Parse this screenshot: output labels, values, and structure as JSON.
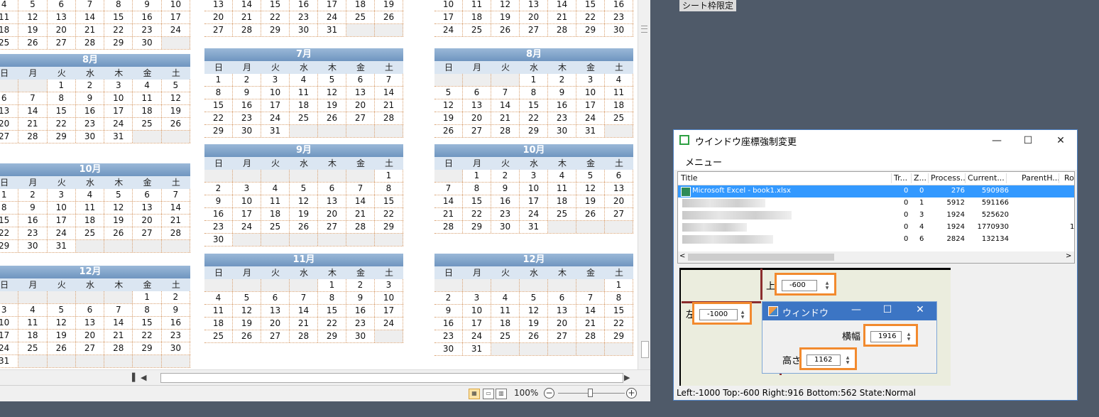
{
  "excel": {
    "calendars": [
      {
        "id": "col1-top",
        "month": "",
        "weekdays": [],
        "weeks": [
          [
            "4",
            "5",
            "6",
            "7",
            "8",
            "9",
            "10"
          ],
          [
            "11",
            "12",
            "13",
            "14",
            "15",
            "16",
            "17"
          ],
          [
            "18",
            "19",
            "20",
            "21",
            "22",
            "23",
            "24"
          ],
          [
            "25",
            "26",
            "27",
            "28",
            "29",
            "30",
            ""
          ]
        ]
      },
      {
        "id": "col1-aug",
        "month": "8月",
        "weekdays": [
          "日",
          "月",
          "火",
          "水",
          "木",
          "金",
          "土"
        ],
        "weeks": [
          [
            "",
            "",
            "1",
            "2",
            "3",
            "4",
            "5"
          ],
          [
            "6",
            "7",
            "8",
            "9",
            "10",
            "11",
            "12"
          ],
          [
            "13",
            "14",
            "15",
            "16",
            "17",
            "18",
            "19"
          ],
          [
            "20",
            "21",
            "22",
            "23",
            "24",
            "25",
            "26"
          ],
          [
            "27",
            "28",
            "29",
            "30",
            "31",
            "",
            ""
          ]
        ]
      },
      {
        "id": "col1-oct",
        "month": "10月",
        "weekdays": [
          "日",
          "月",
          "火",
          "水",
          "木",
          "金",
          "土"
        ],
        "weeks": [
          [
            "1",
            "2",
            "3",
            "4",
            "5",
            "6",
            "7"
          ],
          [
            "8",
            "9",
            "10",
            "11",
            "12",
            "13",
            "14"
          ],
          [
            "15",
            "16",
            "17",
            "18",
            "19",
            "20",
            "21"
          ],
          [
            "22",
            "23",
            "24",
            "25",
            "26",
            "27",
            "28"
          ],
          [
            "29",
            "30",
            "31",
            "",
            "",
            "",
            ""
          ]
        ]
      },
      {
        "id": "col1-dec",
        "month": "12月",
        "weekdays": [
          "日",
          "月",
          "火",
          "水",
          "木",
          "金",
          "土"
        ],
        "weeks": [
          [
            "",
            "",
            "",
            "",
            "",
            "1",
            "2"
          ],
          [
            "3",
            "4",
            "5",
            "6",
            "7",
            "8",
            "9"
          ],
          [
            "10",
            "11",
            "12",
            "13",
            "14",
            "15",
            "16"
          ],
          [
            "17",
            "18",
            "19",
            "20",
            "21",
            "22",
            "23"
          ],
          [
            "24",
            "25",
            "26",
            "27",
            "28",
            "29",
            "30"
          ],
          [
            "31",
            "",
            "",
            "",
            "",
            "",
            ""
          ]
        ]
      },
      {
        "id": "col2-top",
        "month": "",
        "weekdays": [],
        "weeks": [
          [
            "13",
            "14",
            "15",
            "16",
            "17",
            "18",
            "19"
          ],
          [
            "20",
            "21",
            "22",
            "23",
            "24",
            "25",
            "26"
          ],
          [
            "27",
            "28",
            "29",
            "30",
            "31",
            "",
            ""
          ]
        ]
      },
      {
        "id": "col2-jul",
        "month": "7月",
        "weekdays": [
          "日",
          "月",
          "火",
          "水",
          "木",
          "金",
          "土"
        ],
        "weeks": [
          [
            "1",
            "2",
            "3",
            "4",
            "5",
            "6",
            "7"
          ],
          [
            "8",
            "9",
            "10",
            "11",
            "12",
            "13",
            "14"
          ],
          [
            "15",
            "16",
            "17",
            "18",
            "19",
            "20",
            "21"
          ],
          [
            "22",
            "23",
            "24",
            "25",
            "26",
            "27",
            "28"
          ],
          [
            "29",
            "30",
            "31",
            "",
            "",
            "",
            ""
          ]
        ]
      },
      {
        "id": "col2-sep",
        "month": "9月",
        "weekdays": [
          "日",
          "月",
          "火",
          "水",
          "木",
          "金",
          "土"
        ],
        "weeks": [
          [
            "",
            "",
            "",
            "",
            "",
            "",
            "1"
          ],
          [
            "2",
            "3",
            "4",
            "5",
            "6",
            "7",
            "8"
          ],
          [
            "9",
            "10",
            "11",
            "12",
            "13",
            "14",
            "15"
          ],
          [
            "16",
            "17",
            "18",
            "19",
            "20",
            "21",
            "22"
          ],
          [
            "23",
            "24",
            "25",
            "26",
            "27",
            "28",
            "29"
          ],
          [
            "30",
            "",
            "",
            "",
            "",
            "",
            ""
          ]
        ]
      },
      {
        "id": "col2-nov",
        "month": "11月",
        "weekdays": [
          "日",
          "月",
          "火",
          "水",
          "木",
          "金",
          "土"
        ],
        "weeks": [
          [
            "",
            "",
            "",
            "",
            "1",
            "2",
            "3"
          ],
          [
            "4",
            "5",
            "6",
            "7",
            "8",
            "9",
            "10"
          ],
          [
            "11",
            "12",
            "13",
            "14",
            "15",
            "16",
            "17"
          ],
          [
            "18",
            "19",
            "20",
            "21",
            "22",
            "23",
            "24"
          ],
          [
            "25",
            "26",
            "27",
            "28",
            "29",
            "30",
            ""
          ]
        ]
      },
      {
        "id": "col3-top",
        "month": "",
        "weekdays": [],
        "weeks": [
          [
            "10",
            "11",
            "12",
            "13",
            "14",
            "15",
            "16"
          ],
          [
            "17",
            "18",
            "19",
            "20",
            "21",
            "22",
            "23"
          ],
          [
            "24",
            "25",
            "26",
            "27",
            "28",
            "29",
            "30"
          ]
        ]
      },
      {
        "id": "col3-aug",
        "month": "8月",
        "weekdays": [
          "日",
          "月",
          "火",
          "水",
          "木",
          "金",
          "土"
        ],
        "weeks": [
          [
            "",
            "",
            "",
            "1",
            "2",
            "3",
            "4"
          ],
          [
            "5",
            "6",
            "7",
            "8",
            "9",
            "10",
            "11"
          ],
          [
            "12",
            "13",
            "14",
            "15",
            "16",
            "17",
            "18"
          ],
          [
            "19",
            "20",
            "21",
            "22",
            "23",
            "24",
            "25"
          ],
          [
            "26",
            "27",
            "28",
            "29",
            "30",
            "31",
            ""
          ]
        ]
      },
      {
        "id": "col3-oct",
        "month": "10月",
        "weekdays": [
          "日",
          "月",
          "火",
          "水",
          "木",
          "金",
          "土"
        ],
        "weeks": [
          [
            "",
            "1",
            "2",
            "3",
            "4",
            "5",
            "6"
          ],
          [
            "7",
            "8",
            "9",
            "10",
            "11",
            "12",
            "13"
          ],
          [
            "14",
            "15",
            "16",
            "17",
            "18",
            "19",
            "20"
          ],
          [
            "21",
            "22",
            "23",
            "24",
            "25",
            "26",
            "27"
          ],
          [
            "28",
            "29",
            "30",
            "31",
            "",
            "",
            ""
          ]
        ]
      },
      {
        "id": "col3-dec",
        "month": "12月",
        "weekdays": [
          "日",
          "月",
          "火",
          "水",
          "木",
          "金",
          "土"
        ],
        "weeks": [
          [
            "",
            "",
            "",
            "",
            "",
            "",
            "1"
          ],
          [
            "2",
            "3",
            "4",
            "5",
            "6",
            "7",
            "8"
          ],
          [
            "9",
            "10",
            "11",
            "12",
            "13",
            "14",
            "15"
          ],
          [
            "16",
            "17",
            "18",
            "19",
            "20",
            "21",
            "22"
          ],
          [
            "23",
            "24",
            "25",
            "26",
            "27",
            "28",
            "29"
          ],
          [
            "30",
            "31",
            "",
            "",
            "",
            "",
            ""
          ]
        ]
      }
    ],
    "zoom": "100%"
  },
  "sheet_label": "シート枠限定",
  "window": {
    "title": "ウインドウ座標強制変更",
    "menu": "メニュー",
    "columns": [
      "Title",
      "Tr...",
      "Z...",
      "Process...",
      "Current...",
      "ParentH...",
      "Ro"
    ],
    "rows": [
      {
        "title": "Microsoft Excel - book1.xlsx",
        "tr": "0",
        "z": "0",
        "process": "276",
        "current": "590986",
        "parent": ""
      },
      {
        "title": "",
        "tr": "0",
        "z": "1",
        "process": "5912",
        "current": "591166",
        "parent": ""
      },
      {
        "title": "",
        "tr": "0",
        "z": "3",
        "process": "1924",
        "current": "525620",
        "parent": ""
      },
      {
        "title": "",
        "tr": "0",
        "z": "4",
        "process": "1924",
        "current": "1770930",
        "parent": "1"
      },
      {
        "title": "",
        "tr": "0",
        "z": "6",
        "process": "2824",
        "current": "132134",
        "parent": ""
      }
    ],
    "top_label": "上",
    "top_value": "-600",
    "left_label": "左",
    "left_value": "-1000",
    "width_label": "横幅",
    "width_value": "1916",
    "height_label": "高さ",
    "height_value": "1162",
    "status": "Left:-1000 Top:-600 Right:916 Bottom:562 State:Normal"
  },
  "sub_window": {
    "title": "ウィンドウ"
  },
  "colors": {
    "highlight": "#f28a2e",
    "arrow": "#8b2e2e",
    "selection": "#3399ff"
  }
}
